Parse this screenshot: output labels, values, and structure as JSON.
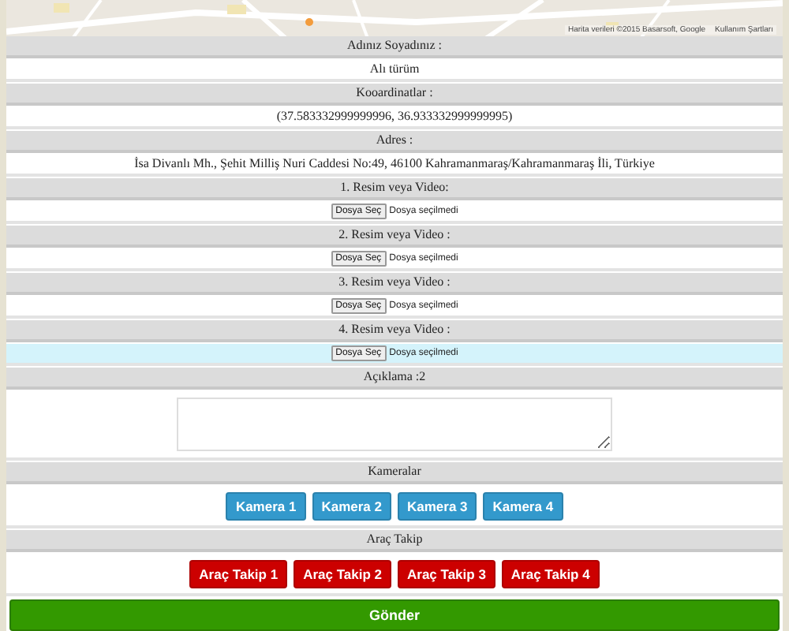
{
  "map": {
    "attribution": "Harita verileri ©2015 Basarsoft, Google",
    "terms": "Kullanım Şartları"
  },
  "sections": [
    {
      "kind": "text",
      "label": "Adınız Soyadınız :",
      "value": "Alı türüm"
    },
    {
      "kind": "text",
      "label": "Kooardinatlar :",
      "value": "(37.583332999999996, 36.933332999999995)"
    },
    {
      "kind": "text",
      "label": "Adres :",
      "value": "İsa Divanlı Mh., Şehit Milliş Nuri Caddesi No:49, 46100 Kahramanmaraş/Kahramanmaraş İli, Türkiye"
    },
    {
      "kind": "file",
      "label": "1. Resim veya Video:",
      "button": "Dosya Seç",
      "status": "Dosya seçilmedi",
      "highlighted": false
    },
    {
      "kind": "file",
      "label": "2. Resim veya Video :",
      "button": "Dosya Seç",
      "status": "Dosya seçilmedi",
      "highlighted": false
    },
    {
      "kind": "file",
      "label": "3. Resim veya Video :",
      "button": "Dosya Seç",
      "status": "Dosya seçilmedi",
      "highlighted": false
    },
    {
      "kind": "file",
      "label": "4. Resim veya Video :",
      "button": "Dosya Seç",
      "status": "Dosya seçilmedi",
      "highlighted": true
    },
    {
      "kind": "textarea",
      "label": "Açıklama :2"
    },
    {
      "kind": "buttons",
      "label": "Kameralar",
      "color": "#3399cc",
      "buttons": [
        "Kamera 1",
        "Kamera 2",
        "Kamera 3",
        "Kamera 4"
      ]
    },
    {
      "kind": "buttons",
      "label": "Araç Takip",
      "color": "#cc0000",
      "buttons": [
        "Araç Takip 1",
        "Araç Takip 2",
        "Araç Takip 3",
        "Araç Takip 4"
      ]
    }
  ],
  "submit": "Gönder"
}
